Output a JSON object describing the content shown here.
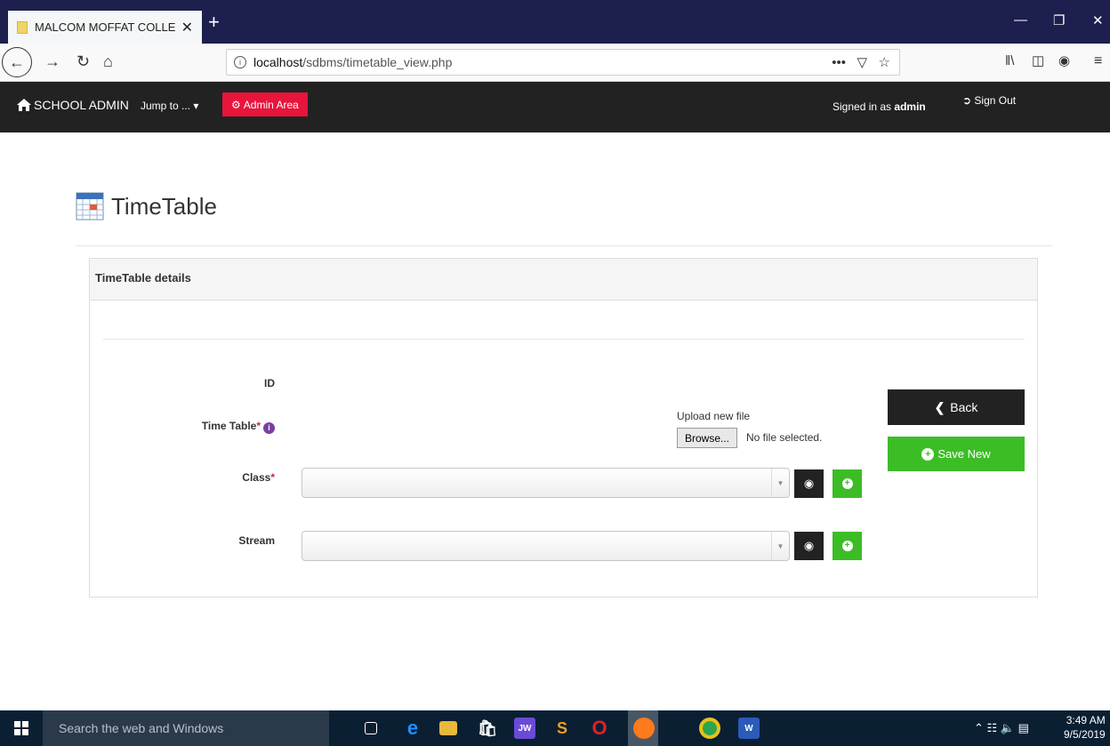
{
  "browser": {
    "tab_title": "MALCOM MOFFAT COLLEGE O",
    "tab_close": "✕",
    "new_tab": "+",
    "url_host": "localhost",
    "url_path": "/sdbms/timetable_view.php",
    "url_dots": "•••"
  },
  "appbar": {
    "brand": "SCHOOL ADMIN",
    "jump_to": "Jump to ... ▾",
    "admin_area": "Admin Area",
    "signed_in_prefix": "Signed in as",
    "signed_in_user": "admin",
    "sign_out": "Sign Out"
  },
  "page": {
    "title": "TimeTable",
    "panel_heading": "TimeTable details"
  },
  "form": {
    "id_label": "ID",
    "timetable_label": "Time Table",
    "upload_label": "Upload new file",
    "browse_label": "Browse...",
    "no_file": "No file selected.",
    "class_label": "Class",
    "stream_label": "Stream",
    "required_mark": "*",
    "info_mark": "i"
  },
  "actions": {
    "back_label": "Back",
    "save_label": "Save New"
  },
  "taskbar": {
    "search_placeholder": "Search the web and Windows",
    "time": "3:49 AM",
    "date": "9/5/2019"
  },
  "colors": {
    "appbar_bg": "#222222",
    "admin_red": "#e8143b",
    "save_green": "#3cbd26",
    "tabstrip": "#1d1f4e"
  }
}
